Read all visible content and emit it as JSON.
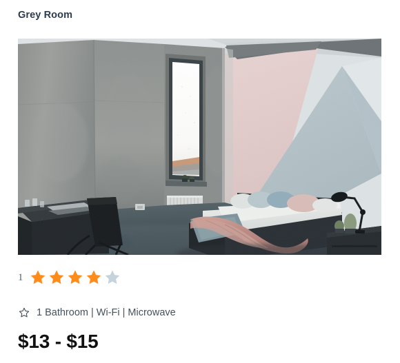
{
  "listing": {
    "title": "Grey Room",
    "price": "$13 - $15",
    "amenities_text": "1 Bathroom | Wi-Fi | Microwave",
    "amenities": [
      "1 Bathroom",
      "Wi-Fi",
      "Microwave"
    ],
    "amenity_separator": "|"
  },
  "rating": {
    "count_label": "1",
    "filled_stars": 4,
    "empty_stars": 1,
    "total_stars": 5,
    "filled_color": "#FF8C1A",
    "empty_color": "#C6D3DC"
  },
  "photo": {
    "alt": "Grey Room interior with concrete wall, window, bed with pink throw, desk and chair",
    "icons": {
      "star_filled": "star-filled-icon",
      "star_empty": "star-empty-icon",
      "amenity_star": "star-outline-icon"
    },
    "palette": {
      "concrete_wall": "#9b9d9b",
      "concrete_wall_dark": "#7e8180",
      "ceiling": "#d9dde0",
      "ceiling_shadow": "#6f7476",
      "wall_pink": "#e3cdcc",
      "wall_blue": "#b7c6cb",
      "wall_white": "#dde3e5",
      "floor": "#4c5a60",
      "bed_base": "#2b3136",
      "bedding_white": "#e6e8e6",
      "bedding_blue": "#8fa4ab",
      "throw_pink": "#c08f86",
      "furniture_dark": "#1b1f22",
      "window_sky": "#fbfbfa",
      "roof_terracotta": "#c08a66"
    }
  },
  "colors": {
    "title_text": "#2d3b4e",
    "body_text": "#44525c",
    "price_text": "#111111",
    "background": "#ffffff"
  }
}
